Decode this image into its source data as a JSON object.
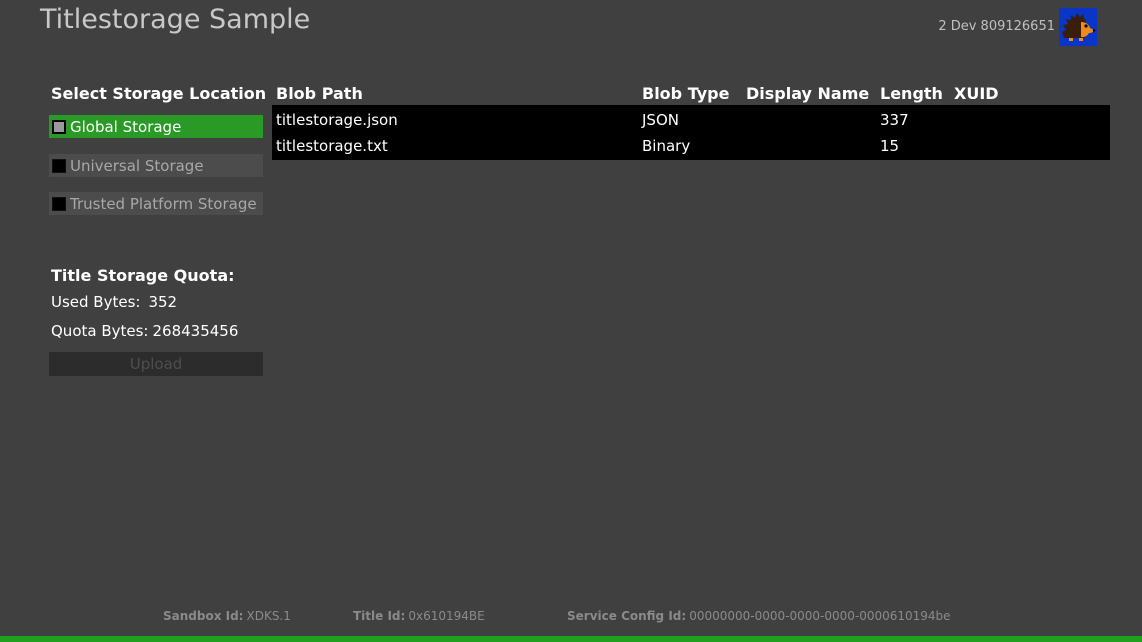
{
  "header": {
    "app_title": "Titlestorage Sample",
    "gamertag": "2 Dev 809126651",
    "avatar_icon": "hedgehog-avatar-icon"
  },
  "storage_location": {
    "heading": "Select Storage Location",
    "options": [
      {
        "label": "Global Storage",
        "selected": true
      },
      {
        "label": "Universal Storage",
        "selected": false
      },
      {
        "label": "Trusted Platform Storage",
        "selected": false
      }
    ]
  },
  "quota": {
    "heading": "Title Storage Quota:",
    "used_label": "Used Bytes:",
    "used_value": "352",
    "quota_label": "Quota Bytes:",
    "quota_value": "268435456",
    "upload_label": "Upload"
  },
  "blob_table": {
    "columns": [
      "Blob Path",
      "Blob Type",
      "Display Name",
      "Length",
      "XUID"
    ],
    "rows": [
      {
        "path": "titlestorage.json",
        "type": "JSON",
        "display_name": "",
        "length": "337",
        "xuid": ""
      },
      {
        "path": "titlestorage.txt",
        "type": "Binary",
        "display_name": "",
        "length": "15",
        "xuid": ""
      }
    ]
  },
  "footer": {
    "sandbox_label": "Sandbox Id:",
    "sandbox_value": "XDKS.1",
    "title_label": "Title Id:",
    "title_value": "0x610194BE",
    "scid_label": "Service Config Id:",
    "scid_value": "00000000-0000-0000-0000-0000610194be"
  },
  "colors": {
    "background": "#404040",
    "selected_green": "#2a9a26",
    "bottom_bar": "#1fa01f",
    "avatar_blue": "#0a36c8"
  }
}
